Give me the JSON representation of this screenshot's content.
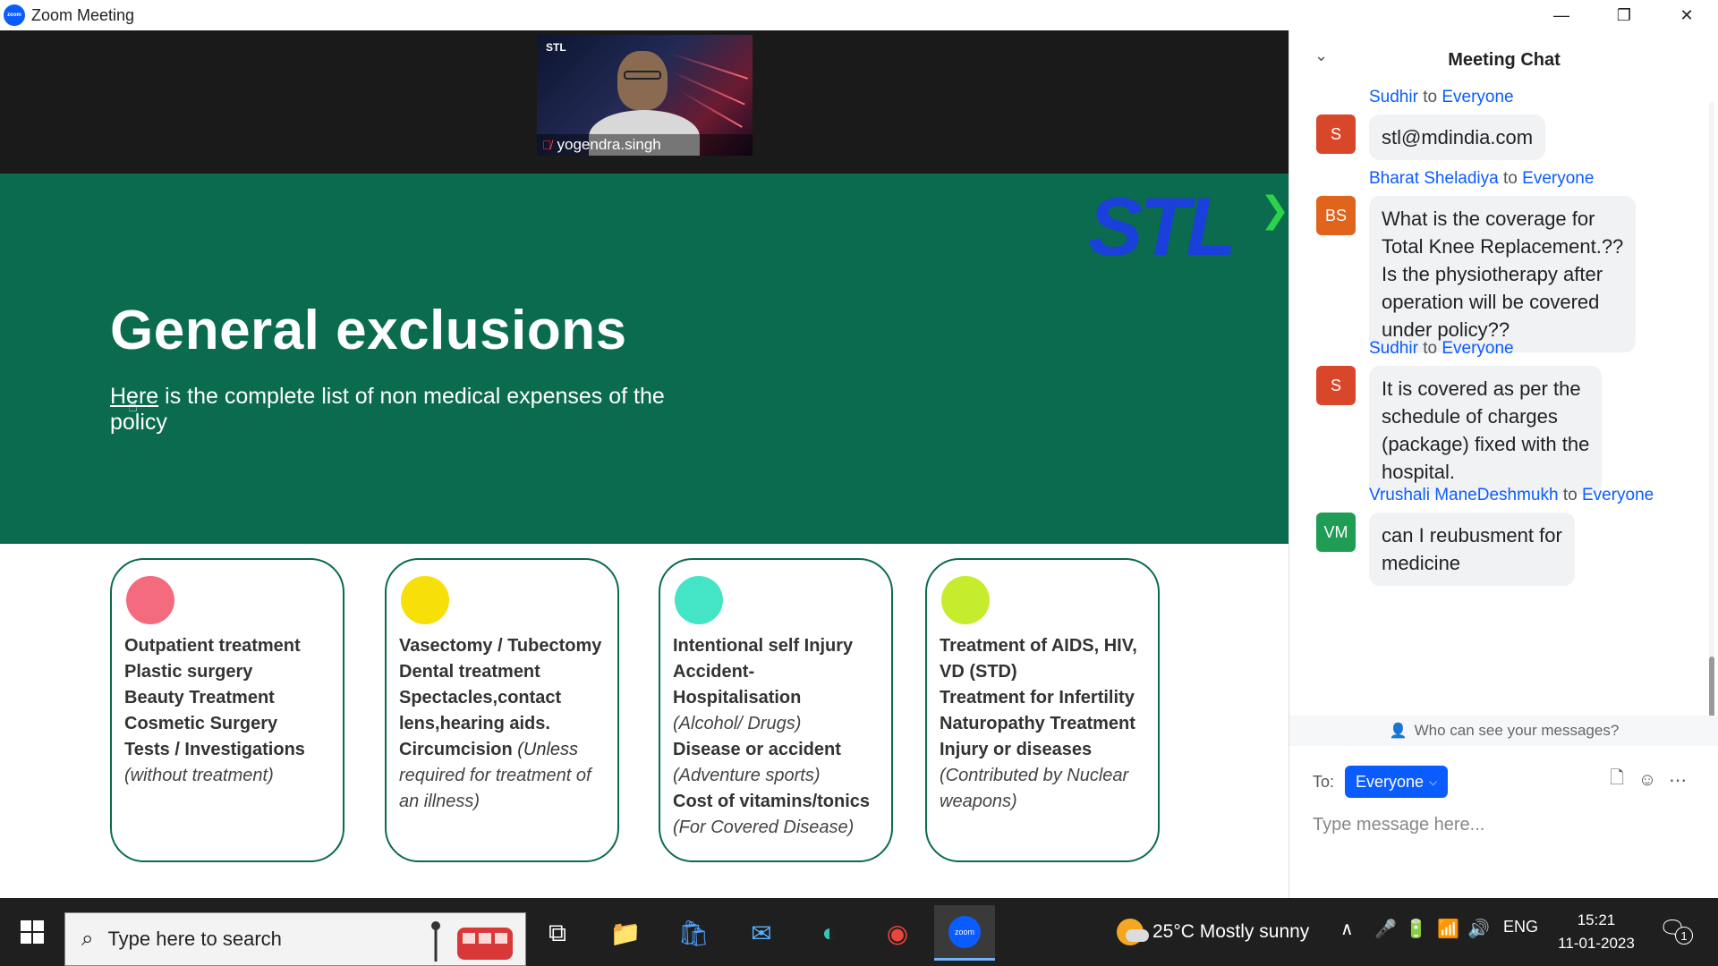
{
  "window": {
    "title": "Zoom Meeting",
    "logo_text": "zoom",
    "controls": {
      "minimize": "—",
      "restore": "❐",
      "close": "✕"
    }
  },
  "video": {
    "logo": "STL",
    "participant_name": "yogendra.singh",
    "mic_icon": "mic-muted-icon"
  },
  "slide": {
    "title": "General exclusions",
    "subtitle_link": "Here",
    "subtitle_rest": " is the complete list of non medical expenses of the policy",
    "logo_text": "STL",
    "cards": [
      {
        "dot_color": "#f46b7e",
        "lines": [
          {
            "text": "Outpatient treatment",
            "style": "b"
          },
          {
            "text": "Plastic surgery",
            "style": "b"
          },
          {
            "text": "Beauty Treatment",
            "style": "b"
          },
          {
            "text": "Cosmetic Surgery",
            "style": "b"
          },
          {
            "text": "Tests / Investigations",
            "style": "b"
          },
          {
            "text": "(without treatment)",
            "style": "i"
          }
        ]
      },
      {
        "dot_color": "#f7df0a",
        "lines": [
          {
            "text": "Vasectomy / Tubectomy",
            "style": "b"
          },
          {
            "text": "Dental treatment",
            "style": "b"
          },
          {
            "text": "Spectacles,contact",
            "style": "b"
          },
          {
            "text": "lens,hearing aids.",
            "style": "b"
          },
          {
            "text": "Circumcision",
            "style": "b",
            "suffix": " (Unless"
          },
          {
            "text": "required for treatment of",
            "style": "i"
          },
          {
            "text": "an illness)",
            "style": "i"
          }
        ]
      },
      {
        "dot_color": "#44e4c6",
        "lines": [
          {
            "text": "Intentional self Injury",
            "style": "b"
          },
          {
            "text": "Accident-Hospitalisation",
            "style": "b"
          },
          {
            "text": "(Alcohol/ Drugs)",
            "style": "i"
          },
          {
            "text": "Disease or accident",
            "style": "b"
          },
          {
            "text": "(Adventure sports)",
            "style": "i"
          },
          {
            "text": "Cost of vitamins/tonics",
            "style": "b"
          },
          {
            "text": "(For Covered Disease)",
            "style": "i"
          }
        ]
      },
      {
        "dot_color": "#c6ec2e",
        "lines": [
          {
            "text": "Treatment of AIDS, HIV,",
            "style": "b"
          },
          {
            "text": "VD (STD)",
            "style": "b"
          },
          {
            "text": "Treatment for Infertility",
            "style": "b"
          },
          {
            "text": "Naturopathy Treatment",
            "style": "b"
          },
          {
            "text": "Injury or diseases",
            "style": "b"
          },
          {
            "text": "(Contributed by Nuclear",
            "style": "i"
          },
          {
            "text": "weapons)",
            "style": "i"
          }
        ]
      }
    ]
  },
  "chat": {
    "title": "Meeting Chat",
    "messages": [
      {
        "sender": "Sudhir",
        "to_word": "to",
        "recipient": "Everyone",
        "initials": "S",
        "avatar_color": "#d9472b",
        "lines": [
          "stl@mdindia.com"
        ]
      },
      {
        "sender": "Bharat Sheladiya",
        "to_word": "to",
        "recipient": "Everyone",
        "initials": "BS",
        "avatar_color": "#e0641c",
        "lines": [
          "What is the coverage for",
          "Total Knee Replacement.??",
          "Is the physiotherapy after",
          "operation will be covered",
          "under policy??"
        ]
      },
      {
        "sender": "Sudhir",
        "to_word": "to",
        "recipient": "Everyone",
        "initials": "S",
        "avatar_color": "#d9472b",
        "lines": [
          "It is covered as per the",
          "schedule of charges",
          "(package) fixed with the",
          "hospital."
        ]
      },
      {
        "sender": "Vrushali ManeDeshmukh",
        "to_word": "to",
        "recipient": "Everyone",
        "initials": "VM",
        "avatar_color": "#1f9d55",
        "lines": [
          "can I reubusment for",
          "medicine"
        ]
      }
    ],
    "who_can_see": "Who can see your messages?",
    "to_label": "To:",
    "to_value": "Everyone",
    "input_placeholder": "Type message here..."
  },
  "taskbar": {
    "search_placeholder": "Type here to search",
    "weather": "25°C  Mostly sunny",
    "language": "ENG",
    "time": "15:21",
    "date": "11-01-2023",
    "notification_count": "1",
    "apps": [
      "task-view-icon",
      "file-explorer-icon",
      "microsoft-store-icon",
      "mail-icon",
      "edge-icon",
      "chrome-icon",
      "zoom-icon"
    ]
  }
}
